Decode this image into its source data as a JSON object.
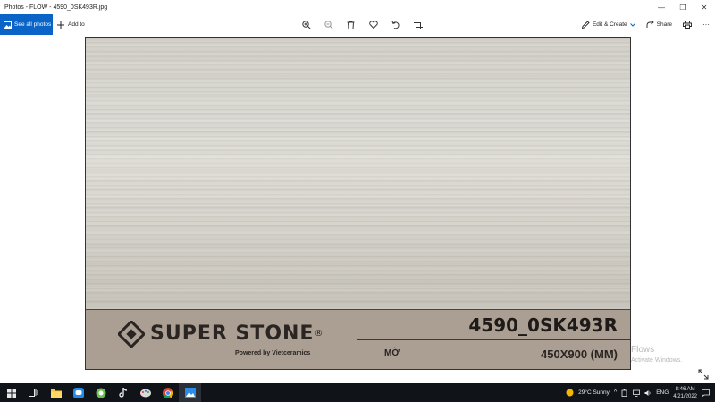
{
  "window": {
    "title": "Photos - FLOW - 4590_0SK493R.jpg",
    "minimize": "—",
    "maximize": "❐",
    "close": "✕"
  },
  "toolbar": {
    "see_all_photos": "See all photos",
    "add_to": "Add to",
    "edit_create": "Edit & Create",
    "share": "Share"
  },
  "photo": {
    "brand": "SUPER STONE",
    "registered": "®",
    "powered_by": "Powered by Vietceramics",
    "product_code": "4590_0SK493R",
    "finish": "MỜ",
    "size": "450X900 (MM)"
  },
  "watermark": {
    "line1": "Flows",
    "line2": "Activate Windows."
  },
  "taskbar": {
    "weather": "29°C  Sunny",
    "language": "ENG",
    "time": "8:46 AM",
    "date": "4/21/2022"
  },
  "colors": {
    "accent": "#0a64c8",
    "panel": "#ab9f93",
    "taskbar": "#101418"
  }
}
